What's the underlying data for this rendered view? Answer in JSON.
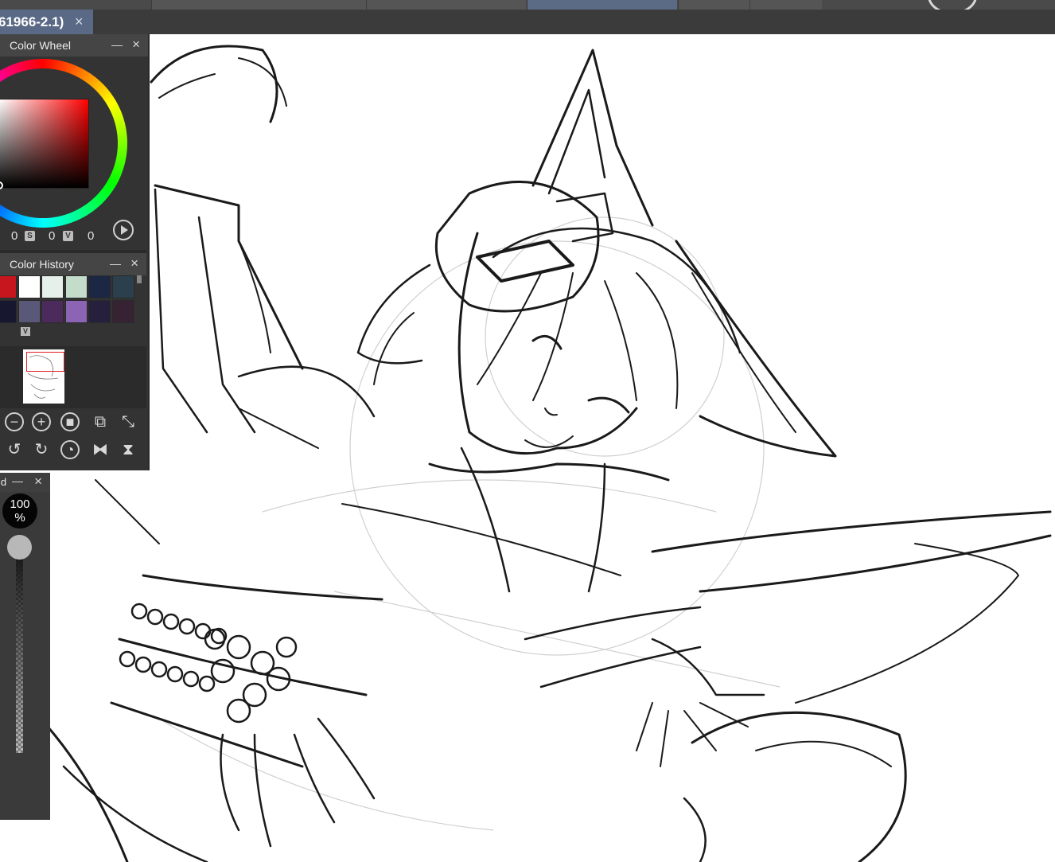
{
  "document_tab": {
    "title": "61966-2.1)",
    "close_glyph": "×"
  },
  "color_wheel_panel": {
    "title": "Color Wheel",
    "minimize_glyph": "—",
    "close_glyph": "×",
    "values": {
      "h": "0",
      "s_badge": "S",
      "s": "0",
      "v_badge": "V",
      "v": "0"
    }
  },
  "color_history_panel": {
    "title": "Color History",
    "minimize_glyph": "—",
    "close_glyph": "×",
    "swatches": [
      "#c8161f",
      "#ffffff",
      "#e6f0ea",
      "#c4ddcb",
      "#1c2743",
      "#2b3f4d",
      "#171730",
      "#5a5878",
      "#4c2a5c",
      "#8b65b4",
      "#27203c",
      "#362232"
    ],
    "expand_badge": "V"
  },
  "navigator": {
    "tools_row1": [
      "zoom-out-icon",
      "zoom-in-icon",
      "fit-icon",
      "actual-size-icon",
      "fullscreen-icon"
    ],
    "tools_row2": [
      "rotate-left-icon",
      "rotate-right-icon",
      "reset-rotation-icon",
      "flip-horizontal-icon",
      "flip-vertical-icon"
    ]
  },
  "opacity_panel": {
    "title": "id",
    "minimize_glyph": "—",
    "close_glyph": "×",
    "value": "100",
    "unit": "%"
  }
}
